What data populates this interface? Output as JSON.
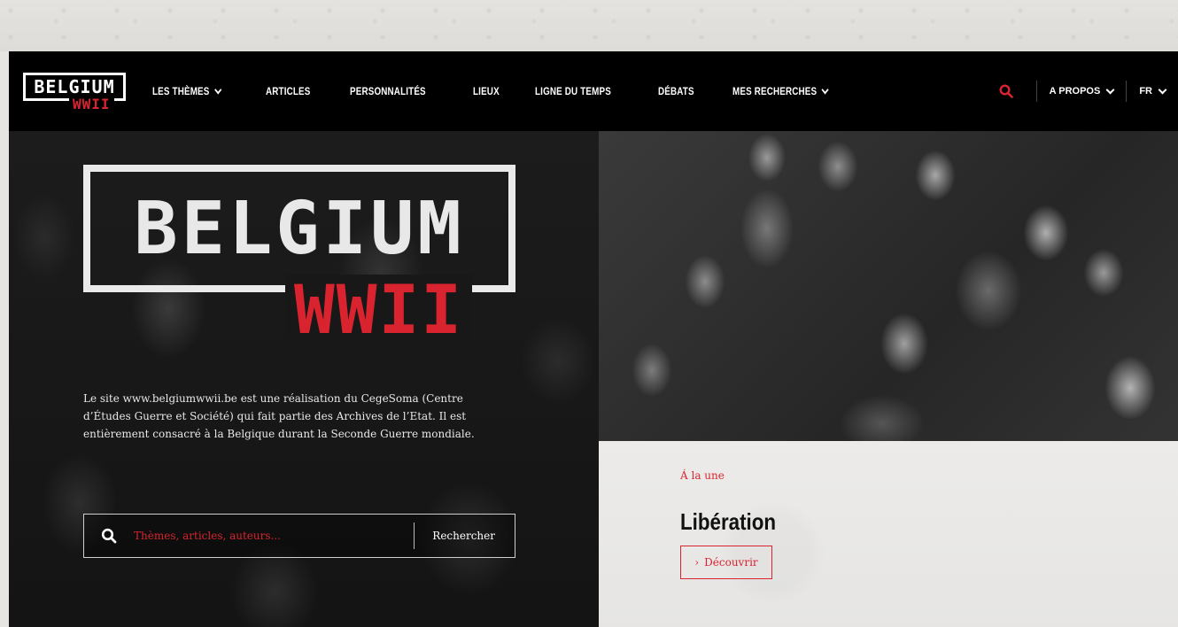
{
  "brand": {
    "logo_main": "BELGIUM",
    "logo_sub": "WWII",
    "accent_color": "#d9242f"
  },
  "nav": {
    "items": [
      {
        "label": "LES THÈMES",
        "dropdown": true
      },
      {
        "label": "ARTICLES",
        "dropdown": false
      },
      {
        "label": "PERSONNALITÉS",
        "dropdown": false
      },
      {
        "label": "LIEUX",
        "dropdown": false
      },
      {
        "label": "LIGNE DU TEMPS",
        "dropdown": false
      },
      {
        "label": "DÉBATS",
        "dropdown": false
      },
      {
        "label": "MES RECHERCHES",
        "dropdown": true
      }
    ],
    "search_icon": "search-icon",
    "about_label": "A PROPOS",
    "lang_label": "FR"
  },
  "hero": {
    "title_main": "BELGIUM",
    "title_sub": "WWII",
    "intro": "Le site www.belgiumwwii.be est une réalisation du CegeSoma (Centre d’Études Guerre et Société) qui fait partie des Archives de l’Etat. Il est entièrement consacré à la Belgique durant la Seconde Guerre mondiale.",
    "search": {
      "placeholder": "Thèmes, articles, auteurs...",
      "value": "",
      "button_label": "Rechercher"
    }
  },
  "feature": {
    "kicker": "Á la une",
    "title": "Libération",
    "button_label": "Découvrir"
  }
}
